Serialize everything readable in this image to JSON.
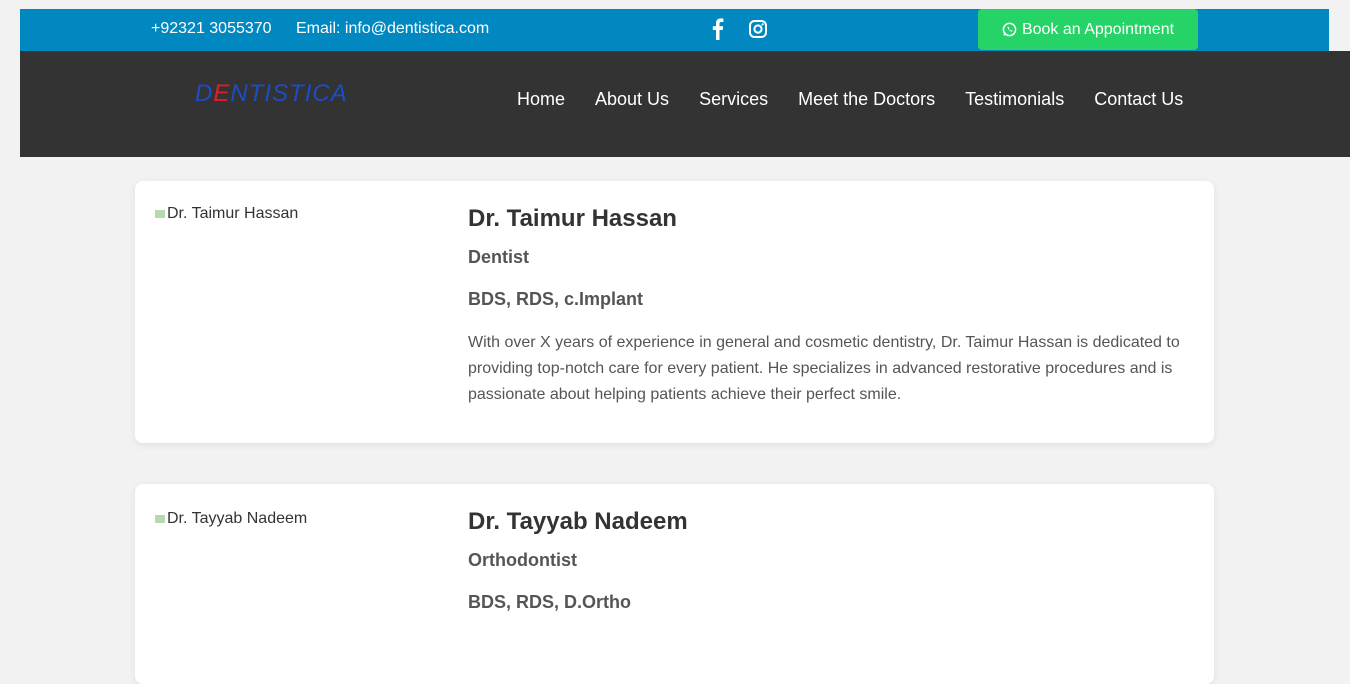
{
  "topbar": {
    "phone": "+92321 3055370",
    "email": "Email: info@dentistica.com",
    "social_icons": [
      "facebook-icon",
      "instagram-icon"
    ],
    "book_label": "Book an Appointment",
    "colors": {
      "bar": "#0288c0",
      "book": "#25d366"
    }
  },
  "navbar": {
    "logo_prefix": "D",
    "logo_e": "E",
    "logo_suffix": "NTISTICA",
    "items": [
      "Home",
      "About Us",
      "Services",
      "Meet the Doctors",
      "Testimonials",
      "Contact Us"
    ]
  },
  "doctors": [
    {
      "photo_alt": "Dr. Taimur Hassan",
      "name": "Dr. Taimur Hassan",
      "specialty": "Dentist",
      "qualifications": "BDS, RDS, c.Implant",
      "bio": "With over X years of experience in general and cosmetic dentistry, Dr. Taimur Hassan is dedicated to providing top-notch care for every patient. He specializes in advanced restorative procedures and is passionate about helping patients achieve their perfect smile."
    },
    {
      "photo_alt": "Dr. Tayyab Nadeem",
      "name": "Dr. Tayyab Nadeem",
      "specialty": "Orthodontist",
      "qualifications": "BDS, RDS, D.Ortho"
    }
  ]
}
